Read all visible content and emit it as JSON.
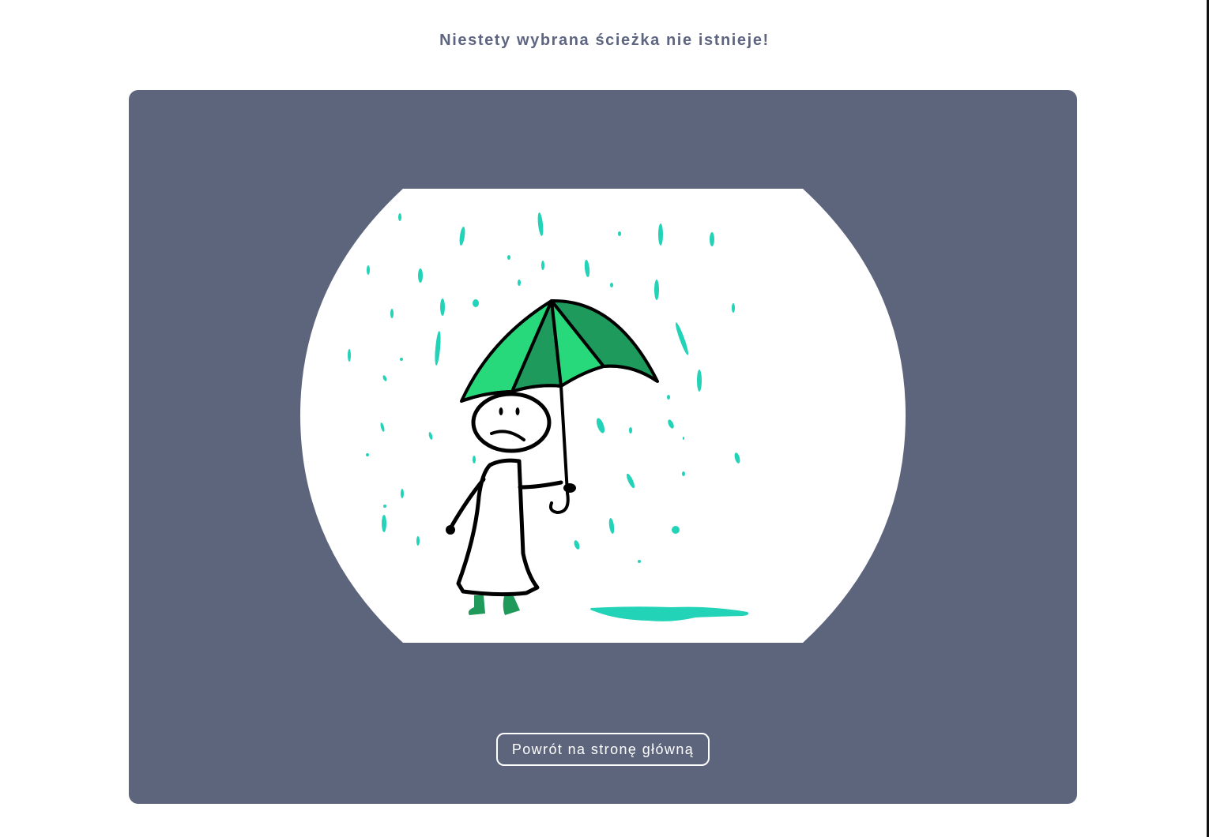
{
  "page": {
    "title": "Niestety wybrana ścieżka nie istnieje!"
  },
  "illustration": {
    "icon": "sad-person-umbrella-rain-illustration",
    "colors": {
      "panel": "#5d657d",
      "rain": "#22d3b8",
      "umbrella_light": "#27d97a",
      "umbrella_dark": "#1d9a5c",
      "boots": "#1f9a5a",
      "outline": "#000000"
    }
  },
  "actions": {
    "home_label": "Powrót na stronę główną"
  }
}
